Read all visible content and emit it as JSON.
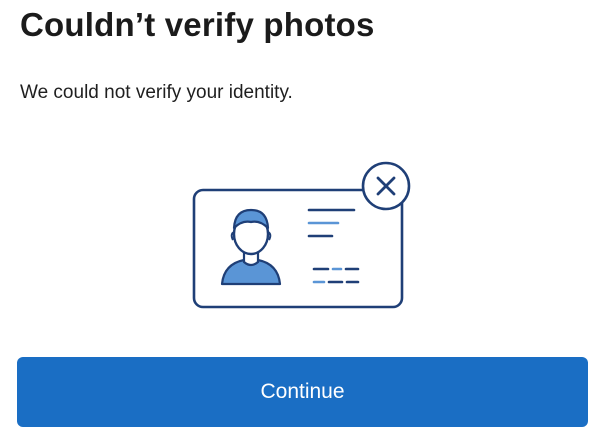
{
  "page": {
    "title": "Couldn’t verify photos",
    "message": "We could not verify your identity."
  },
  "actions": {
    "continue_label": "Continue"
  },
  "illustration": {
    "name": "id-card-verification-failed",
    "icons": [
      "id-card-icon",
      "person-icon",
      "close-icon"
    ]
  },
  "colors": {
    "title_text": "#1b1b1b",
    "button_background": "#1a6ec4",
    "button_text": "#ffffff",
    "illustration_stroke": "#1f3f77",
    "illustration_accent": "#5a95d6"
  }
}
